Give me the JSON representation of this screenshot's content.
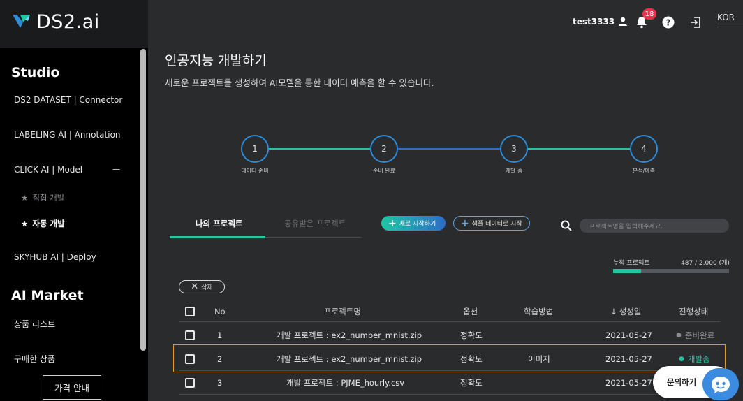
{
  "app": {
    "logo_text": "DS2.ai"
  },
  "sidebar": {
    "studio_title": "Studio",
    "items": [
      {
        "label": "DS2 DATASET | Connector"
      },
      {
        "label": "LABELING AI | Annotation"
      },
      {
        "label": "CLICK AI | Model",
        "toggle": "−"
      },
      {
        "label": "SKYHUB AI | Deploy"
      }
    ],
    "click_sub": [
      {
        "label": "직접 개발",
        "active": false
      },
      {
        "label": "자동 개발",
        "active": true
      }
    ],
    "market_title": "AI Market",
    "market_items": [
      {
        "label": "상품 리스트"
      },
      {
        "label": "구매한 상품"
      }
    ],
    "price_button": "가격 안내"
  },
  "header": {
    "username": "test3333",
    "notification_count": "18",
    "language": "KOR",
    "icons": [
      "user-icon",
      "bell-icon",
      "help-icon",
      "logout-icon"
    ]
  },
  "main": {
    "title": "인공지능 개발하기",
    "description": "새로운 프로젝트를 생성하여 AI모델을 통한 데이터 예측을 할 수 있습니다."
  },
  "steps": [
    {
      "number": "1",
      "label": "데이터 준비"
    },
    {
      "number": "2",
      "label": "준비 완료"
    },
    {
      "number": "3",
      "label": "개발 중"
    },
    {
      "number": "4",
      "label": "분석/예측"
    }
  ],
  "tabs": [
    {
      "label": "나의 프로젝트",
      "active": true
    },
    {
      "label": "공유받은 프로젝트",
      "active": false
    }
  ],
  "actions": {
    "new_start": "새로 시작하기",
    "sample_start": "샘플 데이터로 시작",
    "search_placeholder": "프로젝트명을 입력해주세요."
  },
  "usage": {
    "label": "누적 프로젝트",
    "value": "487 / 2,000 (개)",
    "fraction": 0.2435
  },
  "delete_button": "삭제",
  "table": {
    "headers": {
      "no": "No",
      "name": "프로젝트명",
      "option": "옵션",
      "method": "학습방법",
      "created": "생성일",
      "status": "진행상태"
    },
    "rows": [
      {
        "no": "1",
        "name": "개발 프로젝트 : ex2_number_mnist.zip",
        "option": "정확도",
        "method": "",
        "created": "2021-05-27",
        "status": "준비완료",
        "status_color": "#8a8d90"
      },
      {
        "no": "2",
        "name": "개발 프로젝트 : ex2_number_mnist.zip",
        "option": "정확도",
        "method": "이미지",
        "created": "2021-05-27",
        "status": "개발중",
        "status_color": "#1fc7a3"
      },
      {
        "no": "3",
        "name": "개발 프로젝트 : PJME_hourly.csv",
        "option": "정확도",
        "method": "",
        "created": "2021-05-27",
        "status": "",
        "status_color": "#1fc7a3"
      }
    ]
  },
  "inquiry": {
    "label": "문의하기"
  },
  "colors": {
    "accent": "#1fc7a3",
    "step_blue": "#2d8bd8",
    "highlight": "#e79b1c",
    "badge": "#e5304e"
  }
}
